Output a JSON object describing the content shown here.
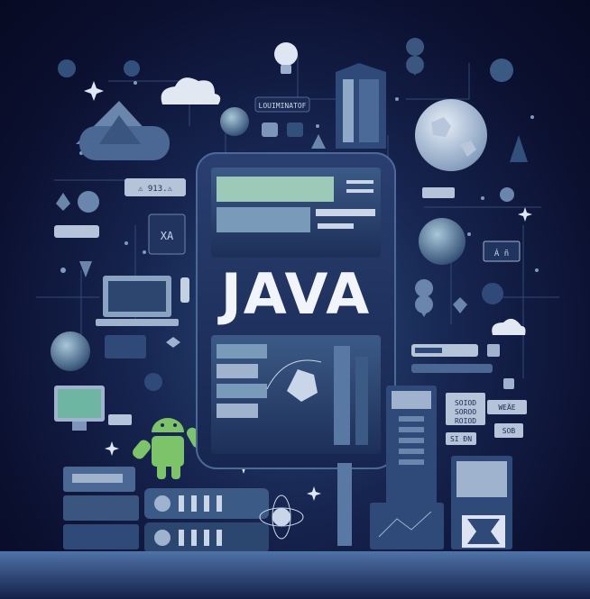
{
  "hero": {
    "title": "JAVA"
  },
  "labels": {
    "top_tag": "LOUIMINATOF",
    "warn_tag": "⚠ 913.⚠",
    "left_sign": "XA",
    "right_sign": "Á ñ",
    "code_top": "SOIOD",
    "code_mid": "SOROO",
    "code_bot": "ROIOD",
    "code_small_a": "SI ĐN",
    "code_small_b": "WEÄE",
    "code_small_c": "SOB"
  },
  "colors": {
    "background": "#0b1030",
    "panel": "#1d2f5c",
    "accent": "#8fd0b4",
    "android": "#7cc36a",
    "text": "#f1f4fa"
  }
}
